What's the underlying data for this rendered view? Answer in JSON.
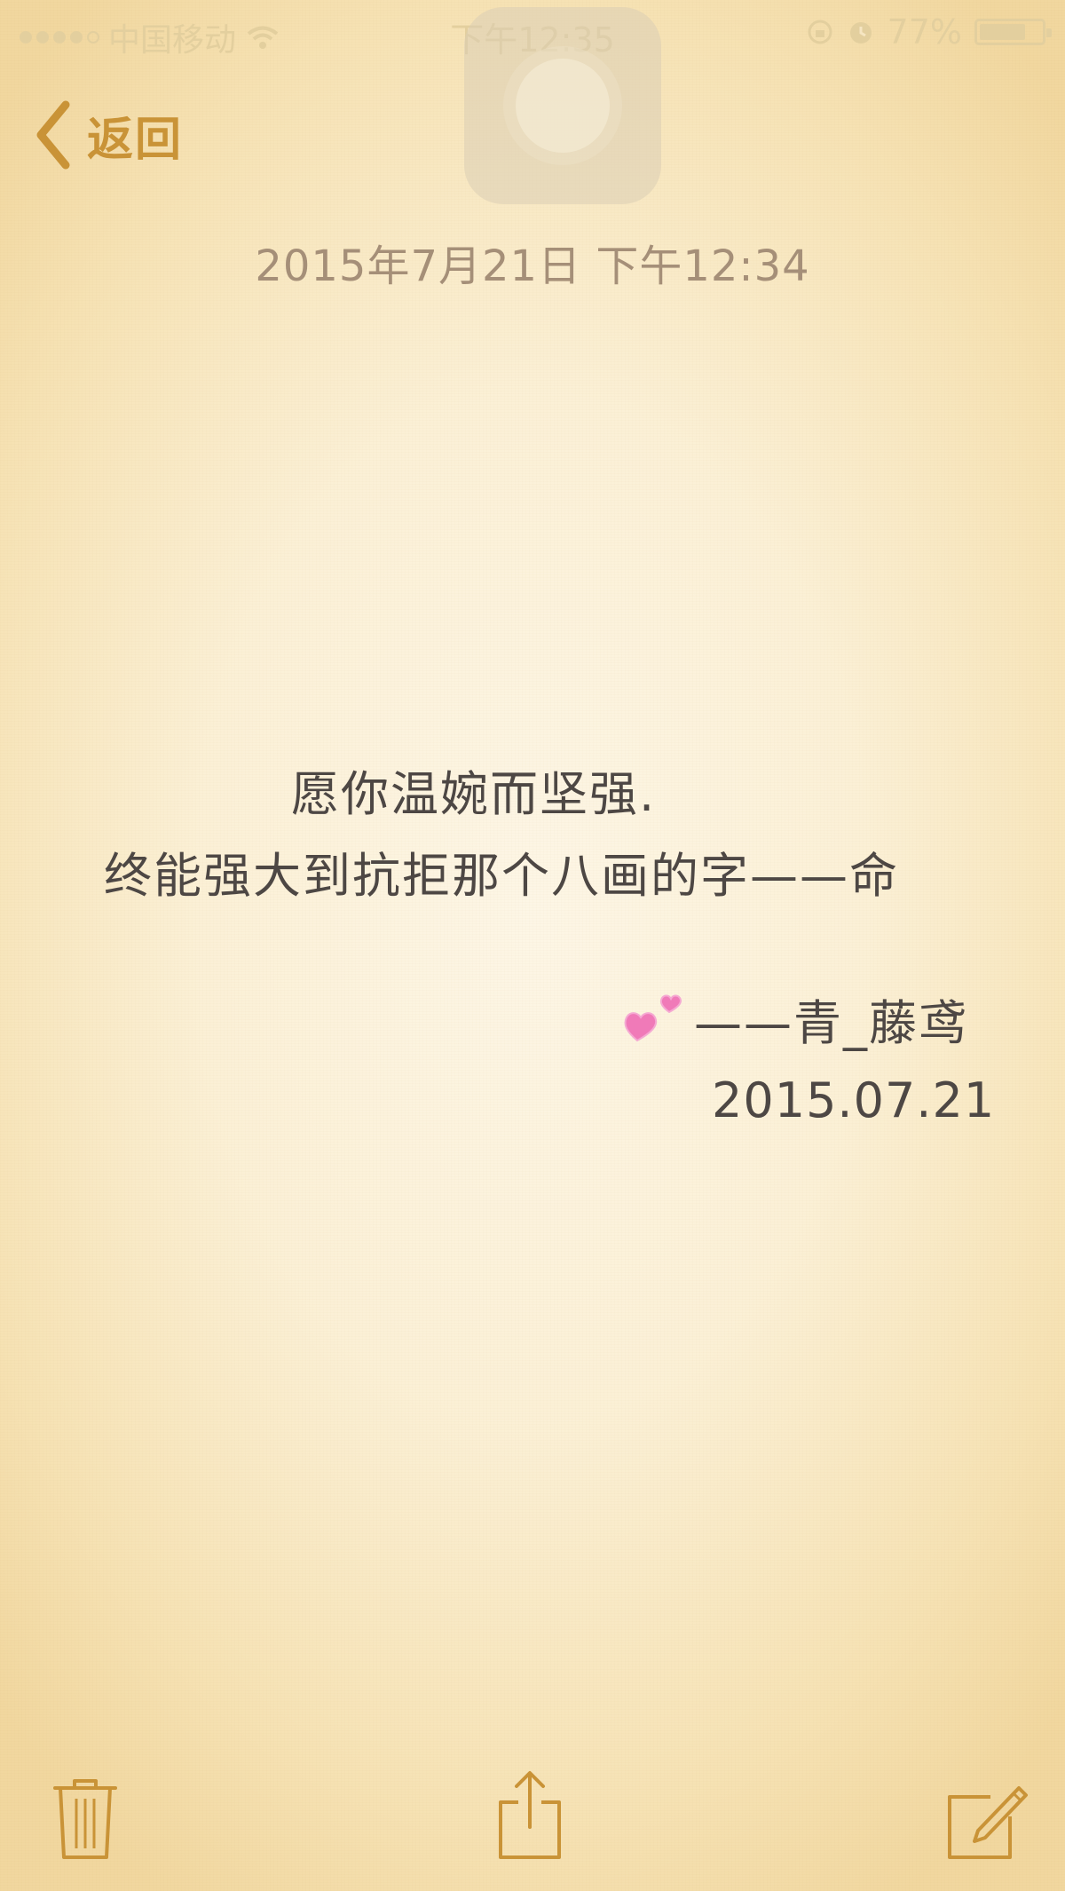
{
  "status_bar": {
    "carrier": "中国移动",
    "time": "下午12:35",
    "battery": "77%",
    "battery_level": 0.77
  },
  "nav": {
    "back_label": "返回"
  },
  "note": {
    "date": "2015年7月21日 下午12:34",
    "line1": "愿你温婉而坚强.",
    "line2": "终能强大到抗拒那个八画的字——命",
    "signature": "——青_藤鸢",
    "sign_date": "2015.07.21"
  },
  "toolbar": {
    "icons": [
      "trash-icon",
      "share-icon",
      "compose-icon"
    ]
  },
  "colors": {
    "accent": "#c99337",
    "text": "#4d4744",
    "date_text": "#a58f78",
    "paper": "#fbf0d6",
    "heart": "#f07ab8"
  }
}
